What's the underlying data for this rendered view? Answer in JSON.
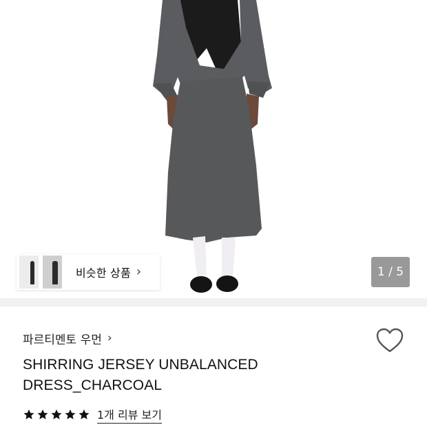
{
  "gallery": {
    "similar_label": "비슷한 상품",
    "counter": "1 / 5"
  },
  "product": {
    "brand": "파르티멘토 우먼",
    "title_line1": "SHIRRING JERSEY UNBALANCED",
    "title_line2": "DRESS_CHARCOAL",
    "rating": 5,
    "review_link": "1개 리뷰 보기"
  },
  "icons": {
    "brand_chevron": "chevron-right-icon",
    "similar_chevron": "chevron-right-icon",
    "wishlist": "heart-outline-icon",
    "star": "star-icon"
  },
  "colors": {
    "dress": "#56585a",
    "stars": "#111111",
    "counter_bg": "#6a6a6a"
  }
}
